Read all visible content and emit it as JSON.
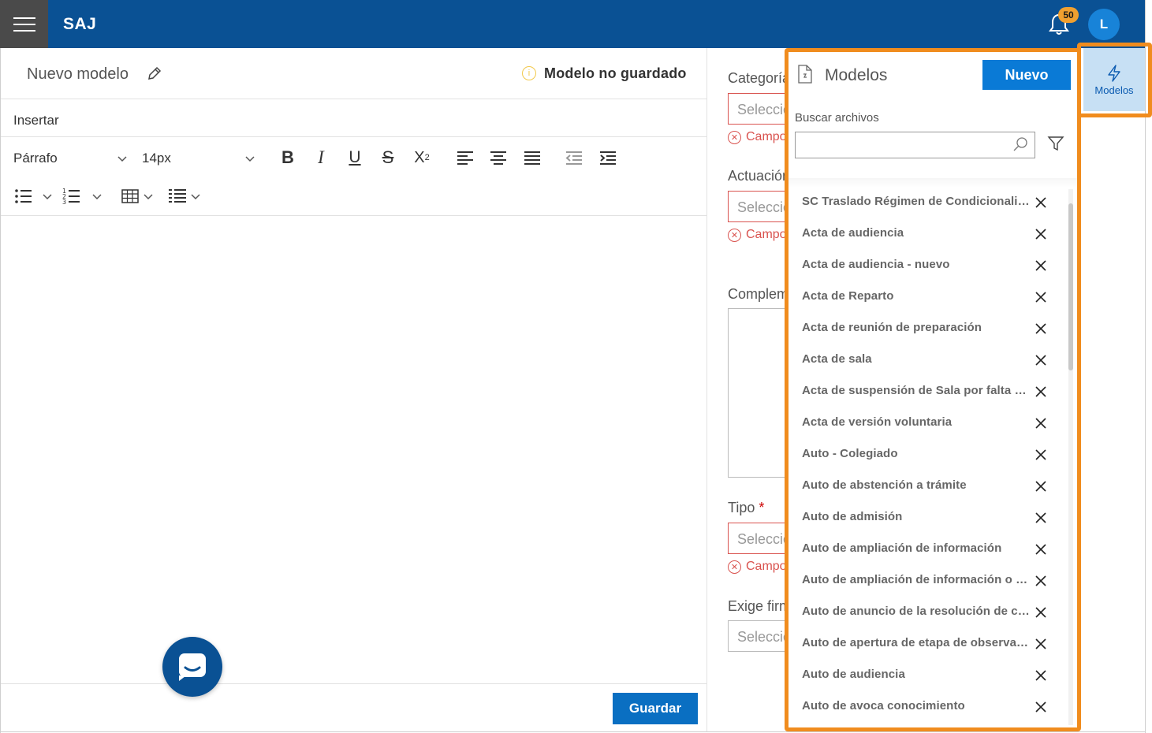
{
  "topbar": {
    "brand": "SAJ",
    "notifications_count": "50",
    "avatar_initial": "L"
  },
  "editor": {
    "title": "Nuevo modelo",
    "status": "Modelo no guardado",
    "insert_menu": "Insertar",
    "paragraph_style": "Párrafo",
    "font_size": "14px",
    "save_label": "Guardar"
  },
  "form": {
    "categoria_label": "Categoría",
    "actuacion_label": "Actuación",
    "complemento_label": "Complem",
    "tipo_label": "Tipo",
    "tipo_required": "*",
    "exige_firma_label": "Exige firm",
    "select_placeholder": "Seleccio",
    "error_text": "Campo"
  },
  "panel": {
    "title": "Modelos",
    "new_button": "Nuevo",
    "search_label": "Buscar archivos",
    "search_value": "",
    "items": [
      "SC Traslado Régimen de Condicionalida...",
      "Acta de audiencia",
      "Acta de audiencia - nuevo",
      "Acta de Reparto",
      "Acta de reunión de preparación",
      "Acta de sala",
      "Acta de suspensión de Sala por falta de ...",
      "Acta de versión voluntaria",
      "Auto - Colegiado",
      "Auto de abstención a trámite",
      "Auto de admisión",
      "Auto de ampliación de información",
      "Auto de ampliación de información o d...",
      "Auto de anuncio de la resolución de co...",
      "Auto de apertura de etapa de observaci...",
      "Auto de audiencia",
      "Auto de avoca conocimiento"
    ]
  },
  "rail": {
    "modelos_label": "Modelos"
  },
  "colors": {
    "brand_blue": "#0a5194",
    "highlight_orange": "#f08c1e",
    "error_red": "#d9534f",
    "button_blue": "#0a7ad6"
  }
}
